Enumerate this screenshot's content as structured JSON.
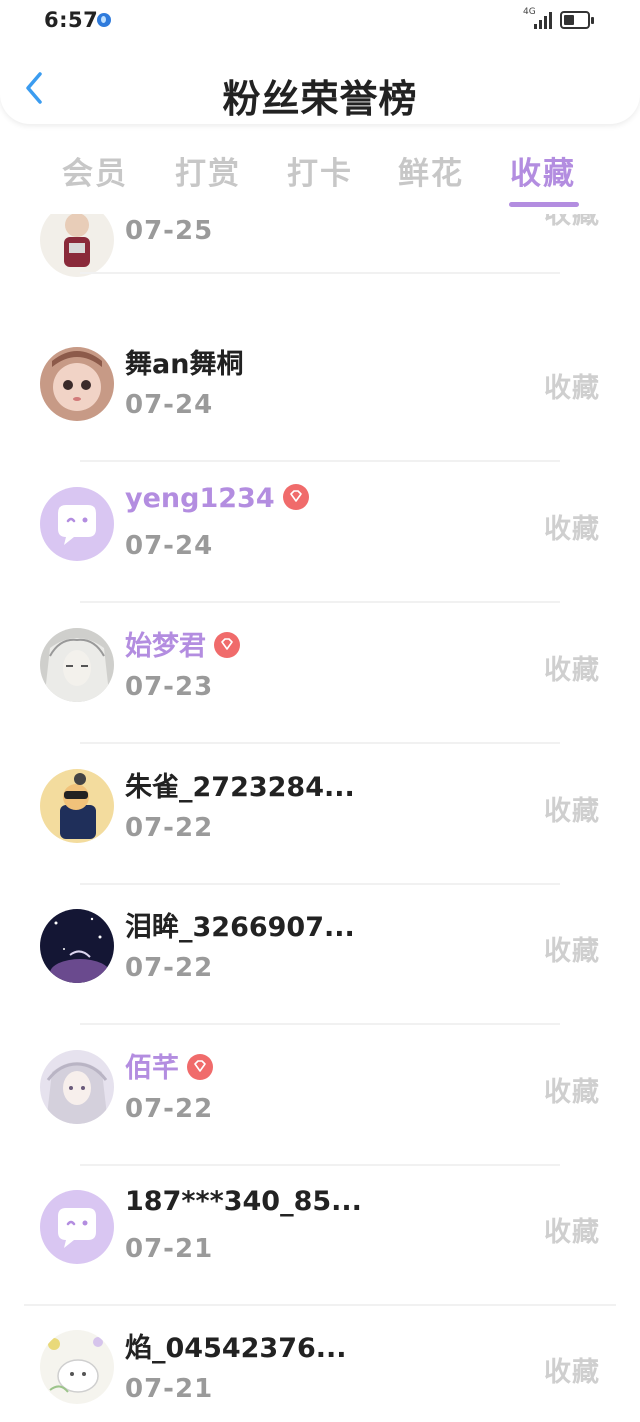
{
  "status_bar": {
    "time": "6:57",
    "network_label": "4G",
    "battery_level": 0.45
  },
  "header": {
    "title": "粉丝荣誉榜",
    "back_icon": "chevron-left-icon"
  },
  "tabs": [
    {
      "label": "会员",
      "active": false
    },
    {
      "label": "打赏",
      "active": false
    },
    {
      "label": "打卡",
      "active": false
    },
    {
      "label": "鲜花",
      "active": false
    },
    {
      "label": "收藏",
      "active": true
    }
  ],
  "colors": {
    "accent": "#b38de0",
    "badge": "#f06b6b",
    "date": "#9a9a9a",
    "action": "#cfcfcf",
    "back_arrow": "#3b9cf0"
  },
  "fans": [
    {
      "name": "",
      "date": "07-25",
      "action": "收藏",
      "vip": false,
      "avatar": "doll-avatar"
    },
    {
      "name": "舞an舞桐",
      "date": "07-24",
      "action": "收藏",
      "vip": false,
      "avatar": "doll-face-avatar"
    },
    {
      "name": "yeng1234",
      "date": "07-24",
      "action": "收藏",
      "vip": true,
      "avatar": "default-chat-avatar"
    },
    {
      "name": "始梦君",
      "date": "07-23",
      "action": "收藏",
      "vip": true,
      "avatar": "anime-sketch-avatar"
    },
    {
      "name": "朱雀_2723284...",
      "date": "07-22",
      "action": "收藏",
      "vip": false,
      "avatar": "cartoon-avatar"
    },
    {
      "name": "泪眸_3266907...",
      "date": "07-22",
      "action": "收藏",
      "vip": false,
      "avatar": "night-sky-avatar"
    },
    {
      "name": "佰芊",
      "date": "07-22",
      "action": "收藏",
      "vip": true,
      "avatar": "anime-girl-avatar"
    },
    {
      "name": "187***340_85...",
      "date": "07-21",
      "action": "收藏",
      "vip": false,
      "avatar": "default-chat-avatar"
    },
    {
      "name": "焰_04542376...",
      "date": "07-21",
      "action": "收藏",
      "vip": false,
      "avatar": "flower-animal-avatar"
    }
  ]
}
